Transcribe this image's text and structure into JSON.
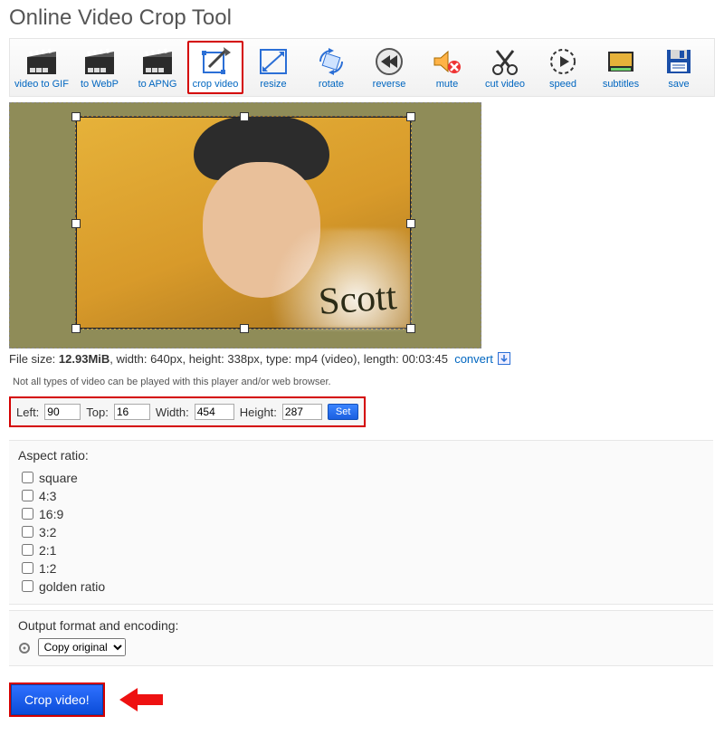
{
  "title": "Online Video Crop Tool",
  "toolbar": {
    "items": [
      {
        "id": "video-to-gif",
        "label": "video to GIF"
      },
      {
        "id": "to-webp",
        "label": "to WebP"
      },
      {
        "id": "to-apng",
        "label": "to APNG"
      },
      {
        "id": "crop-video",
        "label": "crop video"
      },
      {
        "id": "resize",
        "label": "resize"
      },
      {
        "id": "rotate",
        "label": "rotate"
      },
      {
        "id": "reverse",
        "label": "reverse"
      },
      {
        "id": "mute",
        "label": "mute"
      },
      {
        "id": "cut-video",
        "label": "cut video"
      },
      {
        "id": "speed",
        "label": "speed"
      },
      {
        "id": "subtitles",
        "label": "subtitles"
      },
      {
        "id": "save",
        "label": "save"
      }
    ],
    "active_index": 3
  },
  "preview": {
    "watermark_text": "Scott"
  },
  "file_info": {
    "size_label": "File size: ",
    "size_value": "12.93MiB",
    "width_label": ", width: ",
    "width_value": "640px",
    "height_label": ", height: ",
    "height_value": "338px",
    "type_label": ", type: ",
    "type_value": "mp4 (video)",
    "length_label": ", length: ",
    "length_value": "00:03:45",
    "convert_label": "convert"
  },
  "note": "Not all types of video can be played with this player and/or web browser.",
  "coords": {
    "left_label": "Left:",
    "left_value": "90",
    "top_label": "Top:",
    "top_value": "16",
    "width_label": "Width:",
    "width_value": "454",
    "height_label": "Height:",
    "height_value": "287",
    "set_label": "Set"
  },
  "aspect": {
    "title": "Aspect ratio:",
    "options": [
      "square",
      "4:3",
      "16:9",
      "3:2",
      "2:1",
      "1:2",
      "golden ratio"
    ]
  },
  "output": {
    "title": "Output format and encoding:",
    "selected": "Copy original"
  },
  "crop_button_label": "Crop video!"
}
